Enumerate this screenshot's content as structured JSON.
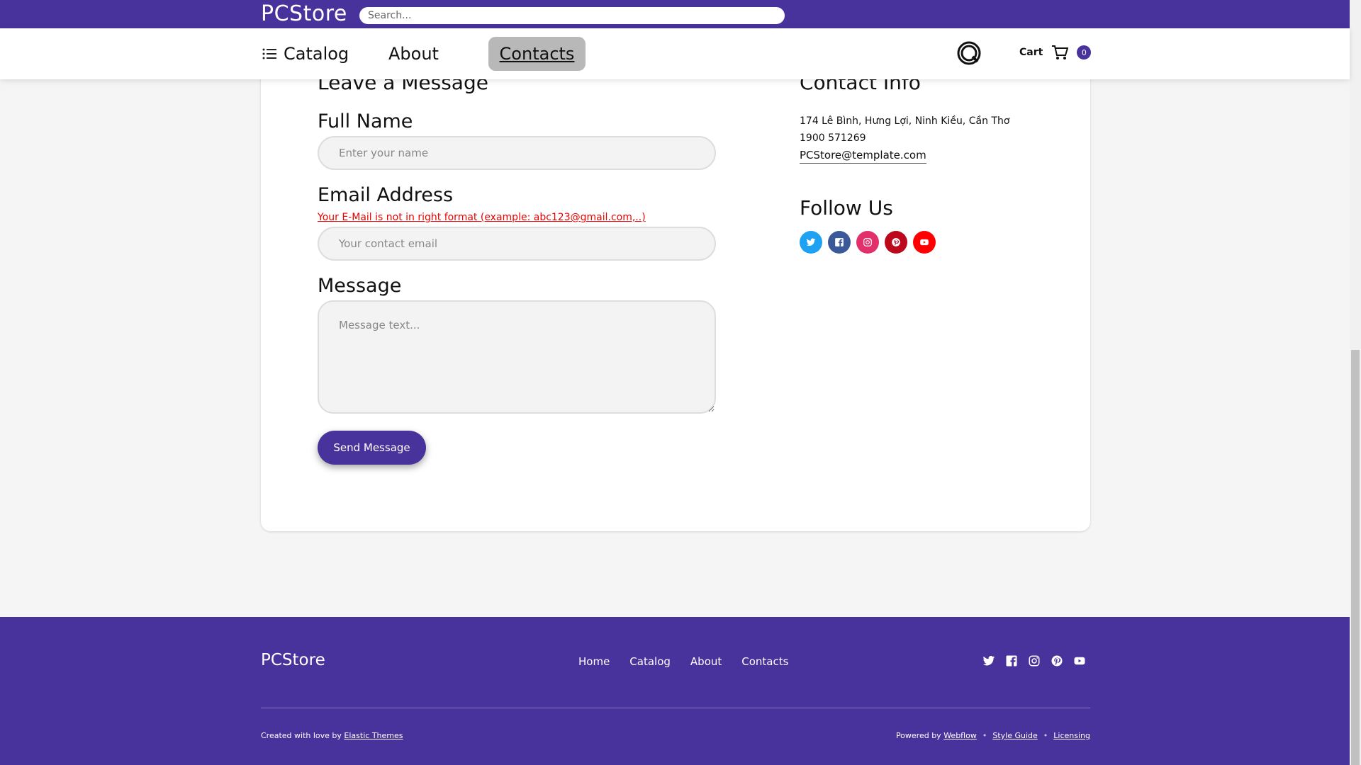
{
  "header": {
    "brand": "PCStore",
    "search_placeholder": "Search..."
  },
  "nav": {
    "catalog": "Catalog",
    "about": "About",
    "contacts": "Contacts",
    "cart_label": "Cart",
    "cart_count": "0"
  },
  "form": {
    "title": "Leave a Message",
    "name_label": "Full Name",
    "name_placeholder": "Enter your name",
    "email_label": "Email Address",
    "email_error": "Your E-Mail is not in right format (example: abc123@gmail.com,..)",
    "email_placeholder": "Your contact email",
    "message_label": "Message",
    "message_placeholder": "Message text...",
    "send_label": "Send Message"
  },
  "contact": {
    "title": "Contact Info",
    "address": "174 Lê Bình, Hưng Lợi, Ninh Kiều, Cần Thơ",
    "phone": "1900 571269",
    "email": "PCStore@template.com",
    "follow_title": "Follow Us",
    "socials": [
      {
        "name": "twitter-icon",
        "color": "#1da1f2"
      },
      {
        "name": "facebook-icon",
        "color": "#3b5998"
      },
      {
        "name": "instagram-icon",
        "color": "#e1306c"
      },
      {
        "name": "pinterest-icon",
        "color": "#bd081c"
      },
      {
        "name": "youtube-icon",
        "color": "#ff0000"
      }
    ]
  },
  "footer": {
    "brand": "PCStore",
    "links": [
      "Home",
      "Catalog",
      "About",
      "Contacts"
    ],
    "created_text": "Created with love by ",
    "created_link": "Elastic Themes",
    "powered_text": "Powered by ",
    "powered_link": "Webflow",
    "style_guide": "Style Guide",
    "licensing": "Licensing",
    "separator": "•"
  },
  "colors": {
    "brand": "#47339b",
    "error": "#e00000"
  }
}
